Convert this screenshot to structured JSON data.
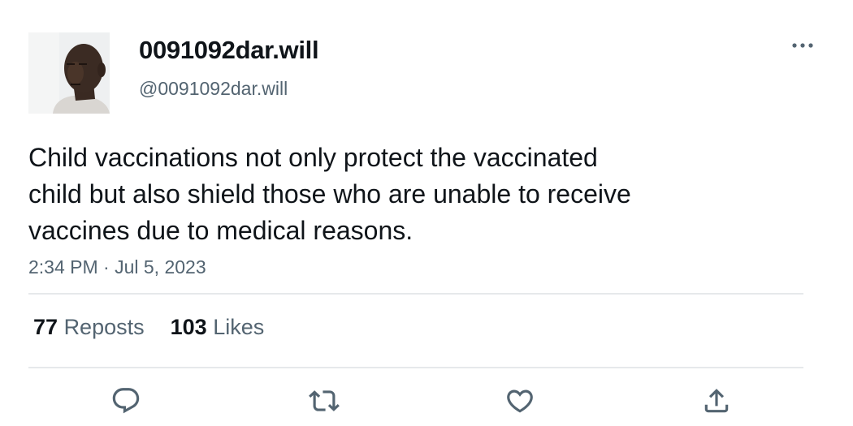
{
  "author": {
    "display_name": "0091092dar.will",
    "handle": "@0091092dar.will"
  },
  "tweet": {
    "text": "Child vaccinations not only protect the vaccinated\nchild but also shield those who are unable to receive\nvaccines due to medical reasons.",
    "timestamp": "2:34 PM · Jul 5, 2023"
  },
  "stats": {
    "reposts_count": "77",
    "reposts_label": "Reposts",
    "likes_count": "103",
    "likes_label": "Likes"
  },
  "actions": [
    {
      "name": "reply",
      "icon": "reply-icon"
    },
    {
      "name": "repost",
      "icon": "repost-icon"
    },
    {
      "name": "like",
      "icon": "heart-icon"
    },
    {
      "name": "share",
      "icon": "share-icon"
    }
  ],
  "colors": {
    "text_primary": "#0f1419",
    "text_secondary": "#536471",
    "divider": "#e6e9eb"
  }
}
